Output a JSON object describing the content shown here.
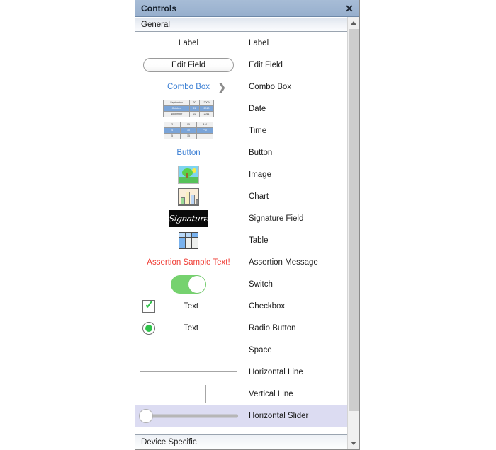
{
  "window": {
    "title": "Controls",
    "close_icon": "close-icon",
    "close_glyph": "✕"
  },
  "groups": {
    "top_label": "General",
    "bottom_label": "Device Specific"
  },
  "scrollbar": {
    "up_icon": "chevron-up-icon",
    "down_icon": "chevron-down-icon"
  },
  "previews": {
    "label_text": "Label",
    "edit_field_text": "Edit Field",
    "combo_box_text": "Combo Box",
    "combo_chevron": "❯",
    "button_text": "Button",
    "assertion_text": "Assertion Sample Text!",
    "checkbox_text": "Text",
    "radio_text": "Text",
    "signature_text": "Signature"
  },
  "date_picker": {
    "rows": [
      {
        "month": "September",
        "day": "20",
        "year": "2009",
        "selected": false
      },
      {
        "month": "October",
        "day": "21",
        "year": "2010",
        "selected": true
      },
      {
        "month": "November",
        "day": "22",
        "year": "2011",
        "selected": false
      }
    ]
  },
  "time_picker": {
    "rows": [
      {
        "hour": "3",
        "minute": "05",
        "meridiem": "AM",
        "selected": false
      },
      {
        "hour": "4",
        "minute": "10",
        "meridiem": "PM",
        "selected": true
      },
      {
        "hour": "5",
        "minute": "15",
        "meridiem": "",
        "selected": false
      }
    ]
  },
  "rows": [
    {
      "label": "Label",
      "name": "control-label",
      "selected": false
    },
    {
      "label": "Edit Field",
      "name": "control-edit-field",
      "selected": false
    },
    {
      "label": "Combo Box",
      "name": "control-combo-box",
      "selected": false
    },
    {
      "label": "Date",
      "name": "control-date",
      "selected": false
    },
    {
      "label": "Time",
      "name": "control-time",
      "selected": false
    },
    {
      "label": "Button",
      "name": "control-button",
      "selected": false
    },
    {
      "label": "Image",
      "name": "control-image",
      "selected": false
    },
    {
      "label": "Chart",
      "name": "control-chart",
      "selected": false
    },
    {
      "label": "Signature Field",
      "name": "control-signature-field",
      "selected": false
    },
    {
      "label": "Table",
      "name": "control-table",
      "selected": false
    },
    {
      "label": "Assertion Message",
      "name": "control-assertion-message",
      "selected": false
    },
    {
      "label": "Switch",
      "name": "control-switch",
      "selected": false
    },
    {
      "label": "Checkbox",
      "name": "control-checkbox",
      "selected": false
    },
    {
      "label": "Radio Button",
      "name": "control-radio-button",
      "selected": false
    },
    {
      "label": "Space",
      "name": "control-space",
      "selected": false
    },
    {
      "label": "Horizontal Line",
      "name": "control-horizontal-line",
      "selected": false
    },
    {
      "label": "Vertical Line",
      "name": "control-vertical-line",
      "selected": false
    },
    {
      "label": "Horizontal Slider",
      "name": "control-horizontal-slider",
      "selected": true
    }
  ],
  "colors": {
    "titlebar": "#9fb6d2",
    "selection": "#dcdcf2",
    "accent_blue": "#3b7fd4",
    "assertion_red": "#ef3a32",
    "switch_green": "#76d26f",
    "check_green": "#2fc24a"
  }
}
